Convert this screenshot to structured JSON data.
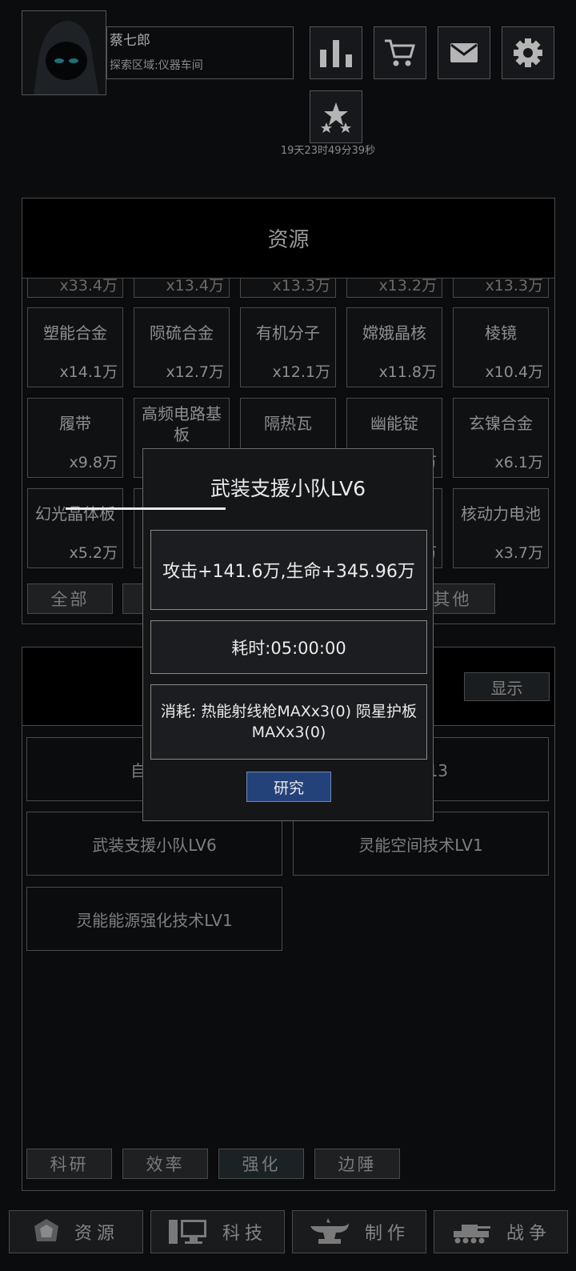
{
  "player": {
    "name": "蔡七郎",
    "area": "探索区域:仪器车间"
  },
  "event_timer": "19天23时49分39秒",
  "resource_panel": {
    "title": "资源",
    "partial_counts": [
      "x33.4万",
      "x13.4万",
      "x13.3万",
      "x13.2万",
      "x13.3万"
    ],
    "rows": [
      [
        {
          "name": "塑能合金",
          "count": "x14.1万"
        },
        {
          "name": "陨硫合金",
          "count": "x12.7万"
        },
        {
          "name": "有机分子",
          "count": "x12.1万"
        },
        {
          "name": "嫦娥晶核",
          "count": "x11.8万"
        },
        {
          "name": "棱镜",
          "count": "x10.4万"
        }
      ],
      [
        {
          "name": "履带",
          "count": "x9.8万"
        },
        {
          "name": "高频电路基板",
          "count": ""
        },
        {
          "name": "隔热瓦",
          "count": ""
        },
        {
          "name": "幽能锭",
          "count": "万"
        },
        {
          "name": "玄镍合金",
          "count": "x6.1万"
        }
      ],
      [
        {
          "name": "幻光晶体板",
          "count": "x5.2万"
        },
        {
          "name": "",
          "count": ""
        },
        {
          "name": "",
          "count": ""
        },
        {
          "name": "",
          "count": "万"
        },
        {
          "name": "核动力电池",
          "count": "x3.7万"
        }
      ]
    ],
    "tabs": [
      "全部",
      "",
      "",
      "",
      "其他"
    ]
  },
  "tech_panel": {
    "show_label": "显示",
    "items": [
      "自适应",
      "甲LV13",
      "武装支援小队LV6",
      "灵能空间技术LV1",
      "灵能能源强化技术LV1"
    ],
    "tabs": [
      "科研",
      "效率",
      "强化",
      "边陲"
    ]
  },
  "bottom_nav": [
    "资源",
    "科技",
    "制作",
    "战争"
  ],
  "dialog": {
    "title": "武装支援小队LV6",
    "effect": "攻击+141.6万,生命+345.96万",
    "time": "耗时:05:00:00",
    "cost": "消耗: 热能射线枪MAXx3(0) 陨星护板MAXx3(0)",
    "button": "研究"
  },
  "colors": {
    "accent_button": "#24427a",
    "background": "#0b0c0e",
    "border": "#4a4a4a"
  },
  "icons": [
    "stats-icon",
    "cart-icon",
    "mail-icon",
    "gear-icon",
    "stars-icon",
    "gem-icon",
    "computer-icon",
    "anvil-icon",
    "tank-icon"
  ]
}
